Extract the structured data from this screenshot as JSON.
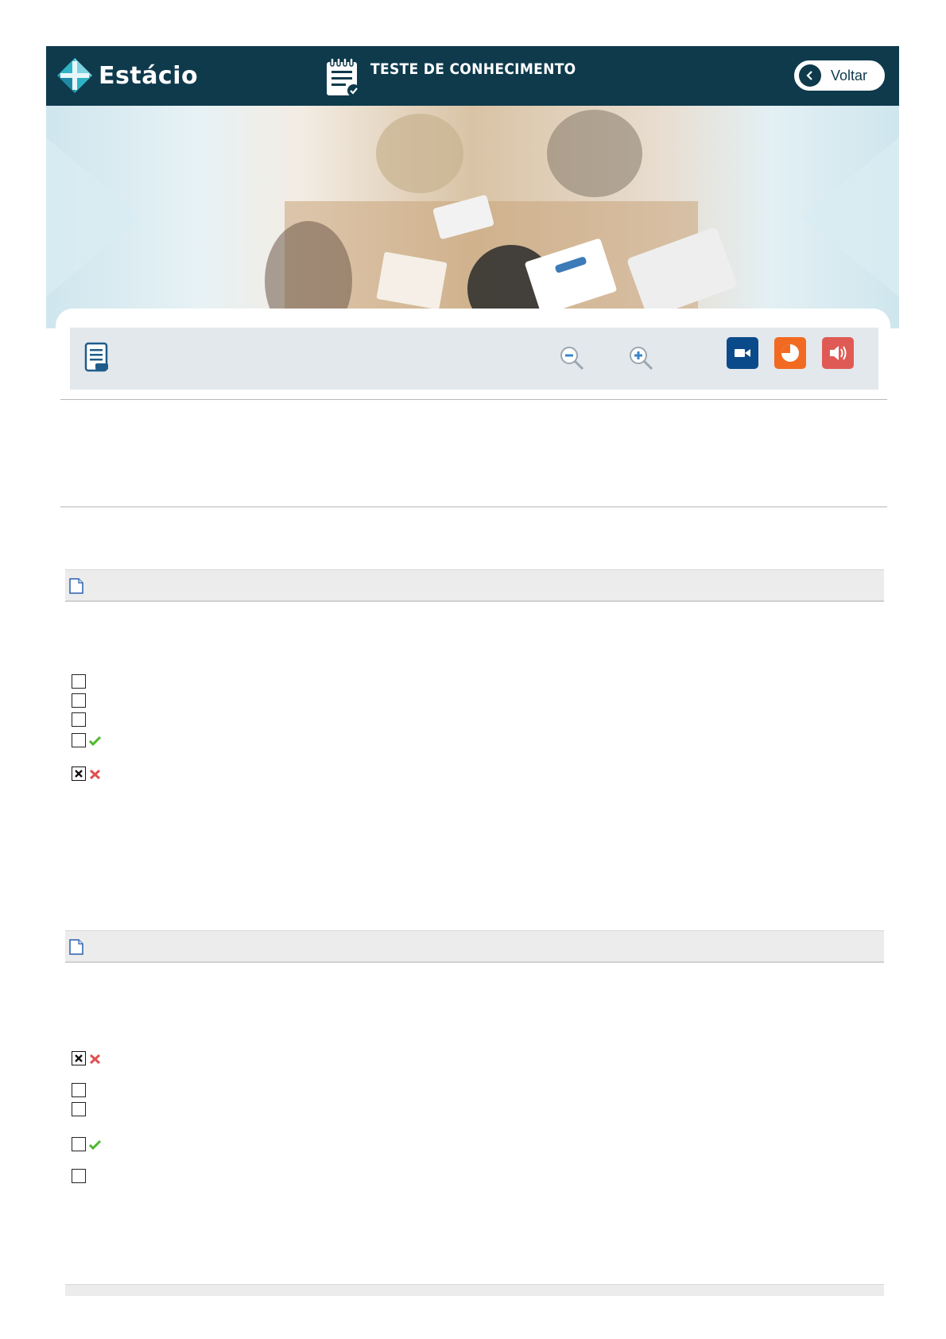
{
  "header": {
    "brand": "Estácio",
    "title": "TESTE DE CONHECIMENTO",
    "back_label": "Voltar"
  },
  "colors": {
    "header_bg": "#0e3a4c",
    "toolbar_bg": "#e3e8ec",
    "video_btn": "#0b4a8a",
    "chart_btn": "#f26a21",
    "audio_btn": "#e05a55",
    "correct": "#4db82e",
    "wrong": "#e05050"
  },
  "toolbar": {
    "icons": [
      "notebook-icon",
      "zoom-out-icon",
      "zoom-in-icon",
      "video-icon",
      "pie-chart-icon",
      "speaker-icon"
    ]
  },
  "questions": [
    {
      "options": [
        {
          "checked": false,
          "mark": ""
        },
        {
          "checked": false,
          "mark": ""
        },
        {
          "checked": false,
          "mark": ""
        },
        {
          "checked": false,
          "mark": "correct"
        },
        {
          "checked": true,
          "mark": "wrong"
        }
      ]
    },
    {
      "options": [
        {
          "checked": true,
          "mark": "wrong"
        },
        {
          "checked": false,
          "mark": ""
        },
        {
          "checked": false,
          "mark": ""
        },
        {
          "checked": false,
          "mark": "correct"
        },
        {
          "checked": false,
          "mark": ""
        }
      ]
    }
  ]
}
